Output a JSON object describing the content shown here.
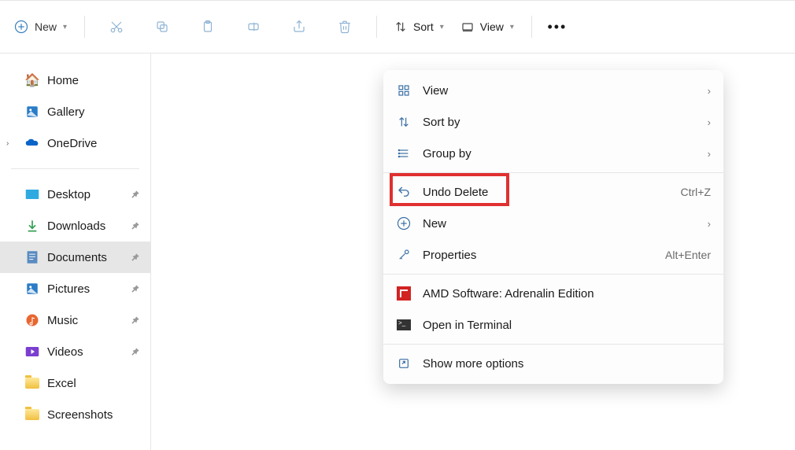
{
  "toolbar": {
    "new_label": "New",
    "sort_label": "Sort",
    "view_label": "View"
  },
  "sidebar": {
    "top": [
      {
        "label": "Home",
        "icon": "home"
      },
      {
        "label": "Gallery",
        "icon": "gallery"
      },
      {
        "label": "OneDrive",
        "icon": "onedrive",
        "expandable": true
      }
    ],
    "pinned": [
      {
        "label": "Desktop",
        "icon": "desktop",
        "pinned": true
      },
      {
        "label": "Downloads",
        "icon": "downloads",
        "pinned": true
      },
      {
        "label": "Documents",
        "icon": "documents",
        "pinned": true,
        "selected": true
      },
      {
        "label": "Pictures",
        "icon": "pictures",
        "pinned": true
      },
      {
        "label": "Music",
        "icon": "music",
        "pinned": true
      },
      {
        "label": "Videos",
        "icon": "videos",
        "pinned": true
      },
      {
        "label": "Excel",
        "icon": "folder"
      },
      {
        "label": "Screenshots",
        "icon": "folder"
      }
    ]
  },
  "context_menu": {
    "items": [
      {
        "label": "View",
        "icon": "view-grid",
        "submenu": true
      },
      {
        "label": "Sort by",
        "icon": "sort",
        "submenu": true
      },
      {
        "label": "Group by",
        "icon": "group",
        "submenu": true
      },
      {
        "separator": true
      },
      {
        "label": "Undo Delete",
        "icon": "undo",
        "shortcut": "Ctrl+Z",
        "highlighted": true
      },
      {
        "label": "New",
        "icon": "new",
        "submenu": true
      },
      {
        "label": "Properties",
        "icon": "properties",
        "shortcut": "Alt+Enter"
      },
      {
        "separator": true
      },
      {
        "label": "AMD Software: Adrenalin Edition",
        "icon": "amd"
      },
      {
        "label": "Open in Terminal",
        "icon": "terminal"
      },
      {
        "separator": true
      },
      {
        "label": "Show more options",
        "icon": "expand"
      }
    ]
  }
}
